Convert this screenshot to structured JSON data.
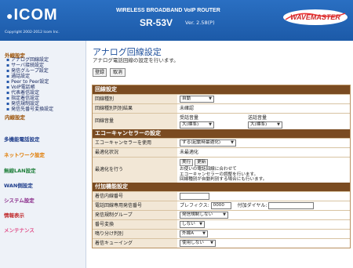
{
  "header": {
    "logo": "ICOM",
    "copyright": "Copyright 2002-2012 Icom Inc.",
    "product_line": "WIRELESS BROADBAND VoIP ROUTER",
    "model": "SR-53V",
    "version": "Ver. 2.58(P)",
    "brand": "WAVEMASTER"
  },
  "sidebar": {
    "category_external": "外線設定",
    "external_items": [
      "アナログ回線設定",
      "サーバ接続設定",
      "発信グループ設定",
      "通話設定"
    ],
    "category_extension": "内線設定",
    "extension_items": [
      "Peer to Peer設定",
      "VoIP電話帳",
      "代表着信設定",
      "指定着信設定",
      "発信規制設定",
      "発信先番号変換設定"
    ],
    "links": [
      "多機能電話設定",
      "ネットワーク設定",
      "無線LAN設定",
      "WAN側設定",
      "システム設定",
      "情報表示",
      "メンテナンス"
    ]
  },
  "main": {
    "title": "アナログ回線設定",
    "description": "アナログ電話回線の設定を行います。",
    "register_button": "登録",
    "cancel_button": "取消",
    "line_section": {
      "title": "回線設定",
      "rows": {
        "line_type_label": "回線種別",
        "line_type_value": "自動",
        "detect_result_label": "回線種別判別結果",
        "detect_result_value": "未確認",
        "volume_label": "回線音量",
        "rx_volume_label": "受話音量",
        "rx_volume_value": "大(標準)",
        "tx_volume_label": "送話音量",
        "tx_volume_value": "大(標準)"
      }
    },
    "echo_section": {
      "title": "エコーキャンセラーの設定",
      "use_label": "エコーキャンセラーを使用",
      "use_value": "する(起動時最適化)",
      "status_label": "最適化状況",
      "status_value": "未最適化",
      "optimize_label": "最適化を行う",
      "run_button": "実行",
      "refresh_button": "更新",
      "note": "お使いの電話回線に合わせて\nエコーキャンセラーの調整を行います。\n回線種別が自動判別する場合にも行います。"
    },
    "extra_section": {
      "title": "付加機能設定",
      "incoming_ext_label": "着信内線番号",
      "incoming_ext_value": "",
      "prefix_label": "電話回線専用発信番号",
      "prefix_prefix_label": "プレフィクス:",
      "prefix_value": "0000",
      "dial_label": "付加ダイヤル:",
      "dial_value": "",
      "group_label": "発信規制グループ",
      "group_value": "発信規制しない",
      "number_convert_label": "番号変換",
      "number_convert_value": "しない",
      "fallback_label": "鳴り分け判別",
      "fallback_value": "外線A",
      "queue_label": "着信キューイング",
      "queue_value": "使用しない"
    }
  }
}
